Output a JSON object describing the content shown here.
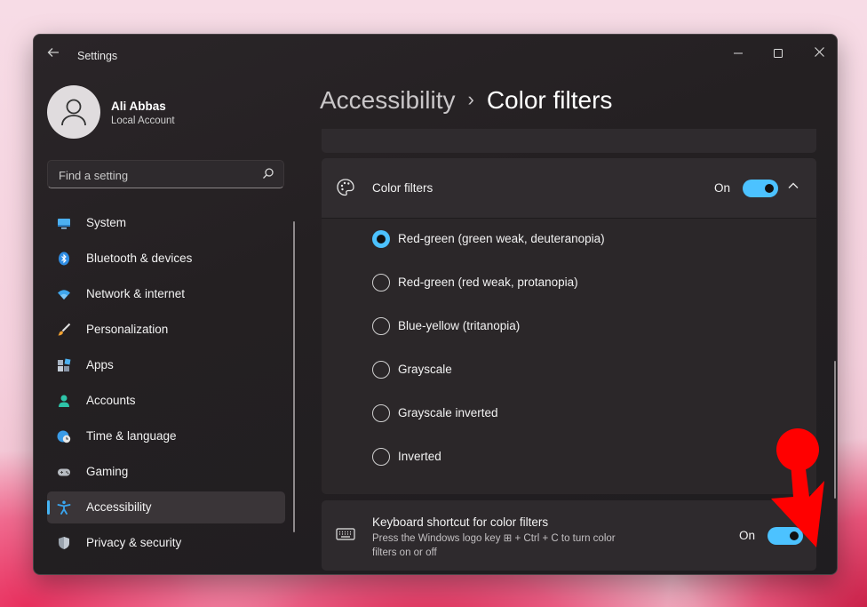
{
  "window": {
    "title": "Settings"
  },
  "user": {
    "name": "Ali Abbas",
    "account_type": "Local Account"
  },
  "search": {
    "placeholder": "Find a setting"
  },
  "sidebar": {
    "items": [
      {
        "label": "System",
        "icon": "monitor-icon"
      },
      {
        "label": "Bluetooth & devices",
        "icon": "bluetooth-icon"
      },
      {
        "label": "Network & internet",
        "icon": "wifi-icon"
      },
      {
        "label": "Personalization",
        "icon": "brush-icon"
      },
      {
        "label": "Apps",
        "icon": "apps-icon"
      },
      {
        "label": "Accounts",
        "icon": "person-icon"
      },
      {
        "label": "Time & language",
        "icon": "globe-clock-icon"
      },
      {
        "label": "Gaming",
        "icon": "gamepad-icon"
      },
      {
        "label": "Accessibility",
        "icon": "accessibility-icon",
        "selected": true
      },
      {
        "label": "Privacy & security",
        "icon": "shield-icon"
      }
    ]
  },
  "breadcrumb": {
    "parent": "Accessibility",
    "separator": "›",
    "current": "Color filters"
  },
  "color_filters": {
    "label": "Color filters",
    "state": "On",
    "enabled": true,
    "options": [
      {
        "label": "Red-green (green weak, deuteranopia)",
        "selected": true
      },
      {
        "label": "Red-green (red weak, protanopia)",
        "selected": false
      },
      {
        "label": "Blue-yellow (tritanopia)",
        "selected": false
      },
      {
        "label": "Grayscale",
        "selected": false
      },
      {
        "label": "Grayscale inverted",
        "selected": false
      },
      {
        "label": "Inverted",
        "selected": false
      }
    ]
  },
  "keyboard_shortcut": {
    "label": "Keyboard shortcut for color filters",
    "desc_line1": "Press the Windows logo key ⊞ + Ctrl + C to turn color",
    "desc_line2": "filters on or off",
    "state": "On",
    "enabled": true
  },
  "colors": {
    "accent": "#4cc2ff",
    "annotation": "#ff0000",
    "selection_indicator": "#46b4f4"
  }
}
